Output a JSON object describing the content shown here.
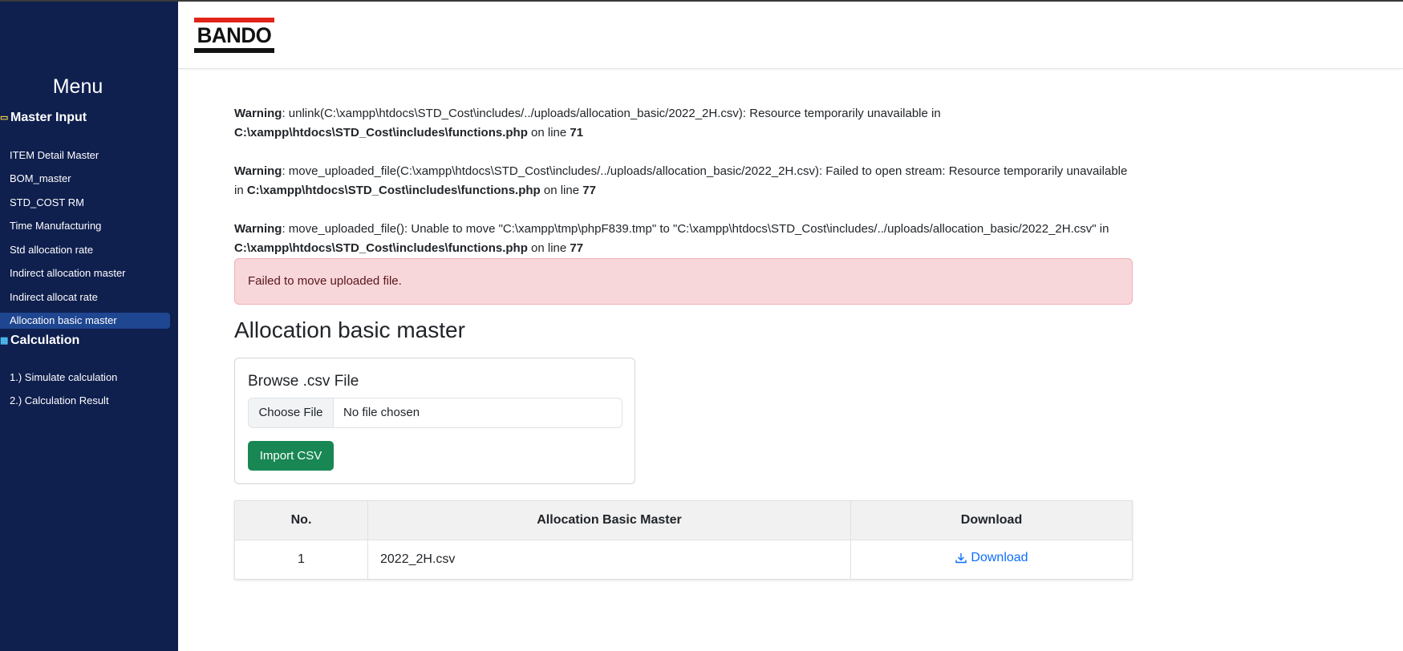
{
  "sidebar": {
    "title": "Menu",
    "sections": [
      {
        "label": "Master Input",
        "icon": "folder-icon",
        "items": [
          {
            "label": "ITEM Detail Master",
            "active": false
          },
          {
            "label": "BOM_master",
            "active": false
          },
          {
            "label": "STD_COST RM",
            "active": false
          },
          {
            "label": "Time Manufacturing",
            "active": false
          },
          {
            "label": "Std allocation rate",
            "active": false
          },
          {
            "label": "Indirect allocation master",
            "active": false
          },
          {
            "label": "Indirect allocat rate",
            "active": false
          },
          {
            "label": "Allocation basic master",
            "active": true
          }
        ]
      },
      {
        "label": "Calculation",
        "icon": "calculator-icon",
        "items": [
          {
            "label": "1.) Simulate calculation",
            "active": false
          },
          {
            "label": "2.) Calculation Result",
            "active": false
          }
        ]
      }
    ]
  },
  "header": {
    "logo_text": "BANDO"
  },
  "warnings": [
    {
      "label": "Warning",
      "message": ": unlink(C:\\xampp\\htdocs\\STD_Cost\\includes/../uploads/allocation_basic/2022_2H.csv): Resource temporarily unavailable in ",
      "file": "C:\\xampp\\htdocs\\STD_Cost\\includes\\functions.php",
      "on_line": " on line ",
      "line": "71"
    },
    {
      "label": "Warning",
      "message": ": move_uploaded_file(C:\\xampp\\htdocs\\STD_Cost\\includes/../uploads/allocation_basic/2022_2H.csv): Failed to open stream: Resource temporarily unavailable in ",
      "file": "C:\\xampp\\htdocs\\STD_Cost\\includes\\functions.php",
      "on_line": " on line ",
      "line": "77"
    },
    {
      "label": "Warning",
      "message": ": move_uploaded_file(): Unable to move \"C:\\xampp\\tmp\\phpF839.tmp\" to \"C:\\xampp\\htdocs\\STD_Cost\\includes/../uploads/allocation_basic/2022_2H.csv\" in ",
      "file": "C:\\xampp\\htdocs\\STD_Cost\\includes\\functions.php",
      "on_line": " on line ",
      "line": "77"
    }
  ],
  "alert": {
    "text": "Failed to move uploaded file."
  },
  "main": {
    "page_title": "Allocation basic master",
    "upload": {
      "title": "Browse .csv File",
      "choose_label": "Choose File",
      "file_name": "No file chosen",
      "import_label": "Import CSV"
    },
    "table": {
      "headers": [
        "No.",
        "Allocation Basic Master",
        "Download"
      ],
      "rows": [
        {
          "no": "1",
          "name": "2022_2H.csv",
          "download": "Download"
        }
      ]
    }
  },
  "colors": {
    "sidebar_bg": "#0f1f4e",
    "active_item": "#1f4690",
    "alert_bg": "#f8d7da",
    "import_button": "#198754",
    "link": "#0d6efd",
    "logo_red": "#e2231a"
  }
}
